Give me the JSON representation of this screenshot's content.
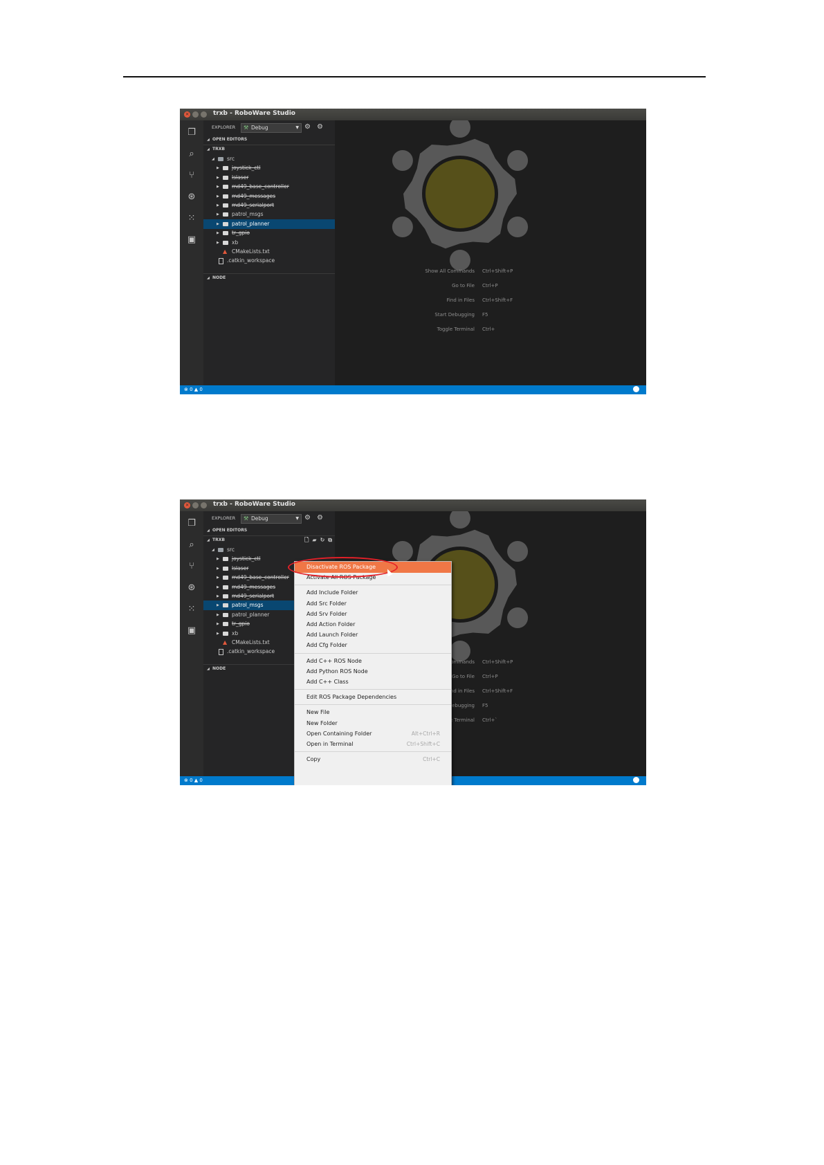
{
  "window": {
    "title": "trxb - RoboWare Studio"
  },
  "explorer": {
    "label": "EXPLORER",
    "config": "Debug"
  },
  "sections": {
    "open_editors": "OPEN EDITORS",
    "project": "TRXB",
    "node": "NODE"
  },
  "tree": {
    "root": "src",
    "packages": [
      {
        "label": "joystick_ctl",
        "disabled": true
      },
      {
        "label": "lslaser",
        "disabled": true
      },
      {
        "label": "md49_base_controller",
        "disabled": true
      },
      {
        "label": "md49_messages",
        "disabled": true
      },
      {
        "label": "md49_serialport",
        "disabled": true
      },
      {
        "label": "patrol_msgs",
        "disabled": false
      },
      {
        "label": "patrol_planner",
        "disabled": false
      },
      {
        "label": "tr_gpio",
        "disabled": true
      },
      {
        "label": "xb",
        "disabled": false
      }
    ],
    "files": [
      "CMakeLists.txt",
      ".catkin_workspace"
    ]
  },
  "screenshot1": {
    "selected_item": "patrol_planner"
  },
  "screenshot2": {
    "selected_item": "patrol_msgs"
  },
  "shortcuts1": [
    {
      "name": "Show All Commands",
      "key": "Ctrl+Shift+P"
    },
    {
      "name": "Go to File",
      "key": "Ctrl+P"
    },
    {
      "name": "Find in Files",
      "key": "Ctrl+Shift+F"
    },
    {
      "name": "Start Debugging",
      "key": "F5"
    },
    {
      "name": "Toggle Terminal",
      "key": "Ctrl+"
    }
  ],
  "shortcuts2": [
    {
      "name": "w All Commands",
      "key": "Ctrl+Shift+P"
    },
    {
      "name": "Go to File",
      "key": "Ctrl+P"
    },
    {
      "name": "Find in Files",
      "key": "Ctrl+Shift+F"
    },
    {
      "name": "Start Debugging",
      "key": "F5"
    },
    {
      "name": "Toggle Terminal",
      "key": "Ctrl+`"
    }
  ],
  "status": {
    "errors": "0",
    "warnings": "0"
  },
  "context_menu": {
    "groups": [
      [
        {
          "label": "Disactivate ROS Package",
          "highlighted": true
        },
        {
          "label": "Activate All ROS Package"
        }
      ],
      [
        {
          "label": "Add Include Folder"
        },
        {
          "label": "Add Src Folder"
        },
        {
          "label": "Add Srv Folder"
        },
        {
          "label": "Add Action Folder"
        },
        {
          "label": "Add Launch Folder"
        },
        {
          "label": "Add Cfg Folder"
        }
      ],
      [
        {
          "label": "Add C++ ROS Node"
        },
        {
          "label": "Add Python ROS Node"
        },
        {
          "label": "Add C++ Class"
        }
      ],
      [
        {
          "label": "Edit ROS Package Dependencies"
        }
      ],
      [
        {
          "label": "New File"
        },
        {
          "label": "New Folder"
        },
        {
          "label": "Open Containing Folder",
          "shortcut": "Alt+Ctrl+R"
        },
        {
          "label": "Open in Terminal",
          "shortcut": "Ctrl+Shift+C"
        }
      ],
      [
        {
          "label": "Copy",
          "shortcut": "Ctrl+C"
        }
      ]
    ]
  },
  "colors": {
    "logo_gray": "#585858",
    "logo_center": "#56501a",
    "status_blue": "#007acc",
    "selection": "#094771",
    "menu_highlight": "#f07746",
    "callout_red": "#e32028"
  }
}
